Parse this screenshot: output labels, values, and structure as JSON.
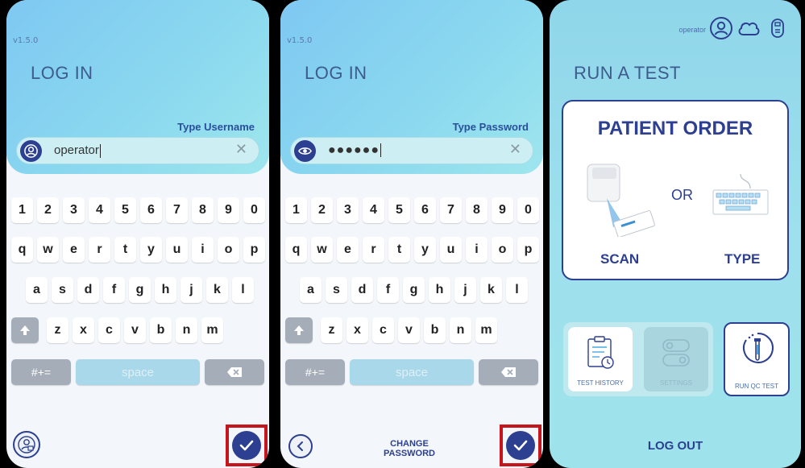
{
  "login_username": {
    "version": "v1.5.0",
    "title": "LOG IN",
    "field_label": "Type Username",
    "field_value": "operator"
  },
  "login_password": {
    "version": "v1.5.0",
    "title": "LOG IN",
    "field_label": "Type Password",
    "field_value": "●●●●●●",
    "change_password_line1": "CHANGE",
    "change_password_line2": "PASSWORD"
  },
  "keyboard": {
    "row_numbers": [
      "1",
      "2",
      "3",
      "4",
      "5",
      "6",
      "7",
      "8",
      "9",
      "0"
    ],
    "row_top": [
      "q",
      "w",
      "e",
      "r",
      "t",
      "y",
      "u",
      "i",
      "o",
      "p"
    ],
    "row_mid": [
      "a",
      "s",
      "d",
      "f",
      "g",
      "h",
      "j",
      "k",
      "l"
    ],
    "row_bottom": [
      "z",
      "x",
      "c",
      "v",
      "b",
      "n",
      "m"
    ],
    "symbols_label": "#+=",
    "space_label": "space"
  },
  "run_test": {
    "user_label": "operator",
    "title": "RUN A TEST",
    "order_title": "PATIENT ORDER",
    "or_label": "OR",
    "scan_label": "SCAN",
    "type_label": "TYPE",
    "test_history_label": "TEST HISTORY",
    "settings_label": "SETTINGS",
    "run_qc_label": "RUN QC TEST",
    "logout_label": "LOG OUT"
  },
  "colors": {
    "brand": "#2c3f90",
    "highlight": "#c4161c"
  }
}
